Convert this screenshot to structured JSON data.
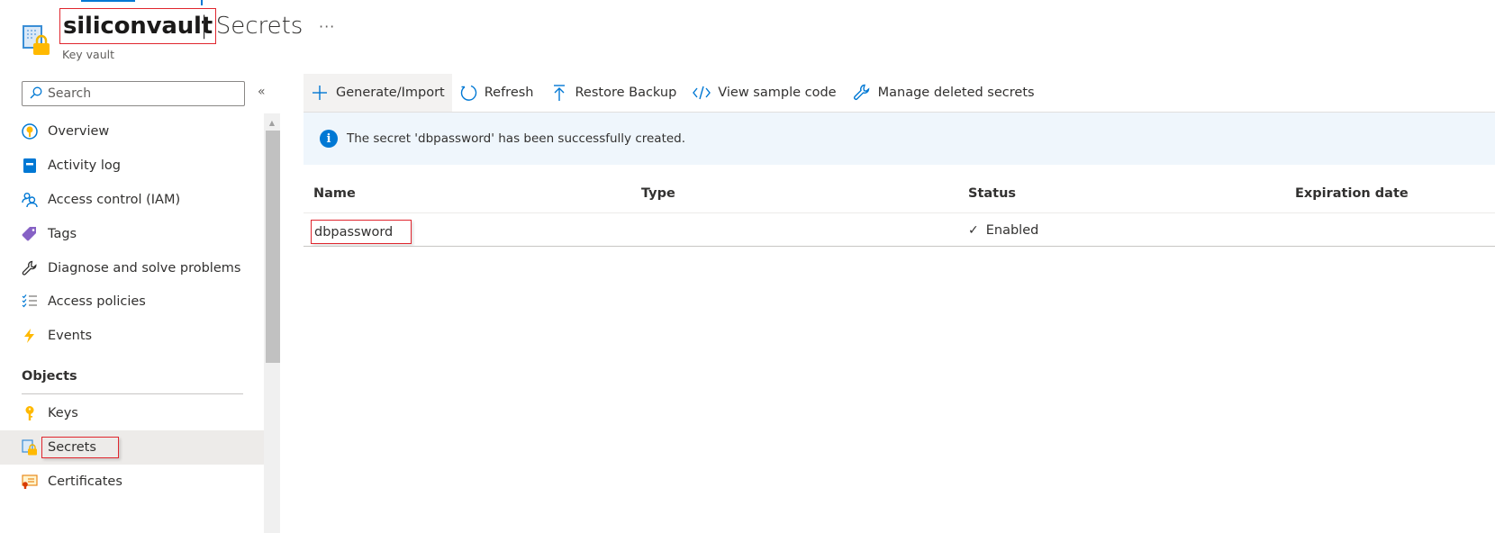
{
  "header": {
    "resource_name": "siliconvault",
    "separator": "|",
    "page_title": "Secrets",
    "resource_type": "Key vault",
    "more_label": "···"
  },
  "sidebar": {
    "search_placeholder": "Search",
    "collapse_label": "«",
    "items": [
      {
        "label": "Overview",
        "icon": "overview-key-icon"
      },
      {
        "label": "Activity log",
        "icon": "activity-log-icon"
      },
      {
        "label": "Access control (IAM)",
        "icon": "people-icon"
      },
      {
        "label": "Tags",
        "icon": "tag-icon"
      },
      {
        "label": "Diagnose and solve problems",
        "icon": "wrench-icon"
      },
      {
        "label": "Access policies",
        "icon": "checklist-icon"
      },
      {
        "label": "Events",
        "icon": "lightning-icon"
      }
    ],
    "section_title": "Objects",
    "object_items": [
      {
        "label": "Keys",
        "icon": "key-icon"
      },
      {
        "label": "Secrets",
        "icon": "secret-lock-icon",
        "selected": true
      },
      {
        "label": "Certificates",
        "icon": "certificate-icon"
      }
    ]
  },
  "toolbar": {
    "generate_import": "Generate/Import",
    "refresh": "Refresh",
    "restore_backup": "Restore Backup",
    "view_sample_code": "View sample code",
    "manage_deleted": "Manage deleted secrets"
  },
  "banner": {
    "message": "The secret 'dbpassword' has been successfully created."
  },
  "table": {
    "columns": [
      "Name",
      "Type",
      "Status",
      "Expiration date"
    ],
    "rows": [
      {
        "name": "dbpassword",
        "type": "",
        "status": "Enabled",
        "expiration": ""
      }
    ]
  },
  "colors": {
    "accent": "#0078d4",
    "highlight_border": "#e0262e",
    "banner_bg": "#eff6fc",
    "selected_bg": "#edebe9"
  }
}
